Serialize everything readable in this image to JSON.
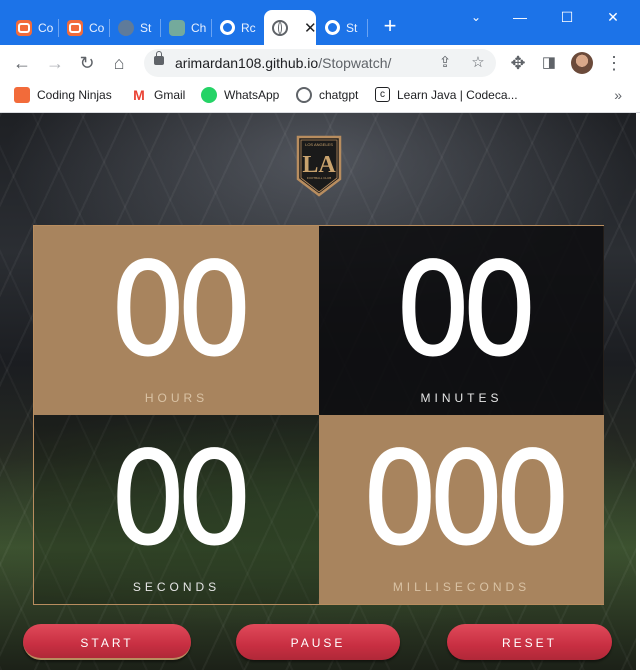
{
  "browser": {
    "tabs": [
      {
        "title": "Co",
        "icon": "coding-ninjas-icon"
      },
      {
        "title": "Co",
        "icon": "coding-ninjas-icon"
      },
      {
        "title": "St",
        "icon": "site-icon"
      },
      {
        "title": "Ch",
        "icon": "chatgpt-icon"
      },
      {
        "title": "Rc",
        "icon": "github-icon"
      },
      {
        "title": "",
        "icon": "globe-icon",
        "active": true
      },
      {
        "title": "St",
        "icon": "github-icon"
      }
    ],
    "url_host": "arimardan108.github.io",
    "url_path": "/Stopwatch/",
    "bookmarks": [
      {
        "label": "Coding Ninjas",
        "icon": "coding-ninjas-icon"
      },
      {
        "label": "Gmail",
        "icon": "gmail-icon"
      },
      {
        "label": "WhatsApp",
        "icon": "whatsapp-icon"
      },
      {
        "label": "chatgpt",
        "icon": "chatgpt-icon"
      },
      {
        "label": "Learn Java | Codeca...",
        "icon": "codecademy-icon"
      }
    ],
    "more_bookmarks": "»"
  },
  "page": {
    "logo": {
      "top_text": "LOS ANGELES",
      "monogram": "LA",
      "bottom_text": "FOOTBALL CLUB"
    },
    "stopwatch": {
      "hours": {
        "value": "00",
        "label": "HOURS"
      },
      "minutes": {
        "value": "00",
        "label": "MINUTES"
      },
      "seconds": {
        "value": "00",
        "label": "SECONDS"
      },
      "milliseconds": {
        "value": "000",
        "label": "MILLISECONDS"
      }
    },
    "buttons": {
      "start": "START",
      "pause": "PAUSE",
      "reset": "RESET"
    }
  },
  "colors": {
    "gold": "#a8845e",
    "button_red": "#d23a4c",
    "tab_strip": "#1c73e8"
  }
}
